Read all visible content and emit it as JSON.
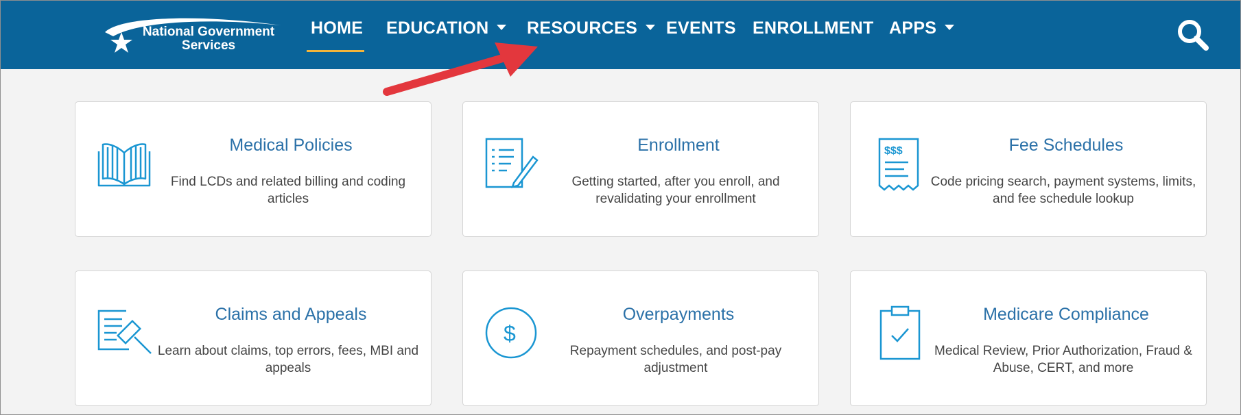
{
  "brand": {
    "line1": "National Government",
    "line2": "Services"
  },
  "nav": {
    "home": "HOME",
    "education": "EDUCATION",
    "resources": "RESOURCES",
    "events": "EVENTS",
    "enrollment": "ENROLLMENT",
    "apps": "APPS",
    "active_item": "HOME"
  },
  "colors": {
    "nav_background": "#0a649a",
    "active_underline": "#f3b43a",
    "card_title": "#2b71a8",
    "icon": "#1a96d2",
    "annotation_arrow": "#e3373d"
  },
  "cards": [
    {
      "title": "Medical Policies",
      "desc": "Find LCDs and related billing and coding articles",
      "icon": "open-book-icon"
    },
    {
      "title": "Enrollment",
      "desc": "Getting started, after you enroll, and revalidating your enrollment",
      "icon": "document-pen-icon"
    },
    {
      "title": "Fee Schedules",
      "desc": "Code pricing search, payment systems, limits, and fee schedule lookup",
      "icon": "receipt-icon"
    },
    {
      "title": "Claims and Appeals",
      "desc": "Learn about claims, top errors, fees, MBI and appeals",
      "icon": "document-gavel-icon"
    },
    {
      "title": "Overpayments",
      "desc": "Repayment schedules, and post-pay adjustment",
      "icon": "dollar-circle-icon"
    },
    {
      "title": "Medicare Compliance",
      "desc": "Medical Review, Prior Authorization, Fraud & Abuse, CERT, and more",
      "icon": "clipboard-check-icon"
    }
  ]
}
